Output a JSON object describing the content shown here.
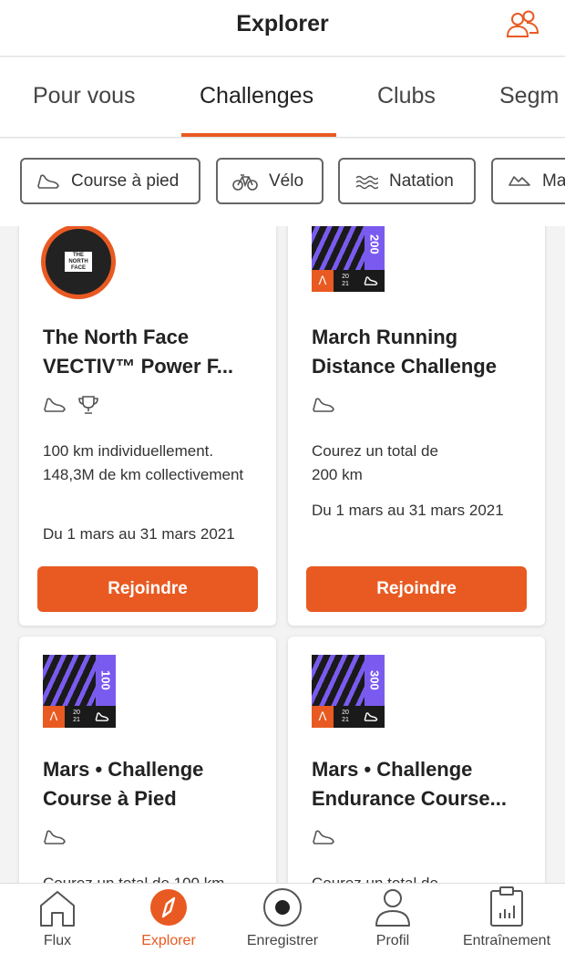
{
  "header": {
    "title": "Explorer",
    "people_icon": "people-icon"
  },
  "tabs": [
    {
      "label": "Pour vous"
    },
    {
      "label": "Challenges",
      "active": true
    },
    {
      "label": "Clubs"
    },
    {
      "label": "Segm"
    }
  ],
  "filters": [
    {
      "label": "Course à pied",
      "icon": "shoe-icon"
    },
    {
      "label": "Vélo",
      "icon": "bike-icon"
    },
    {
      "label": "Natation",
      "icon": "swim-icon"
    },
    {
      "label": "Ma",
      "icon": "hiking-icon"
    }
  ],
  "cards": [
    {
      "name": "The North Face VECTIV™ Power F...",
      "badge": {
        "type": "north-face",
        "text": [
          "THE",
          "NORTH",
          "FACE"
        ]
      },
      "icons": [
        "shoe-icon",
        "trophy-icon"
      ],
      "description": "100 km individuellement. 148,3M de km collectivement",
      "dates": "Du 1 mars au 31 mars 2021",
      "button": "Rejoindre"
    },
    {
      "name": "March Running Distance Challenge",
      "badge": {
        "type": "distance",
        "distance": "200",
        "year_top": "20",
        "year_bottom": "21"
      },
      "icons": [
        "shoe-icon"
      ],
      "description": "Courez un total de 200 km",
      "dates": "Du 1 mars au 31 mars 2021",
      "button": "Rejoindre"
    },
    {
      "name": "Mars • Challenge Course à Pied",
      "badge": {
        "type": "distance",
        "distance": "100",
        "year_top": "20",
        "year_bottom": "21"
      },
      "icons": [
        "shoe-icon"
      ],
      "description": "Courez un total de 100 km"
    },
    {
      "name": "Mars • Challenge Endurance Course...",
      "badge": {
        "type": "distance",
        "distance": "300",
        "year_top": "20",
        "year_bottom": "21"
      },
      "icons": [
        "shoe-icon"
      ],
      "description": "Courez un total de"
    }
  ],
  "bottom_nav": [
    {
      "label": "Flux",
      "icon": "home-icon"
    },
    {
      "label": "Explorer",
      "icon": "compass-icon",
      "active": true
    },
    {
      "label": "Enregistrer",
      "icon": "record-icon"
    },
    {
      "label": "Profil",
      "icon": "profile-icon"
    },
    {
      "label": "Entraînement",
      "icon": "training-icon"
    }
  ],
  "colors": {
    "accent": "#e85a22",
    "badge_purple": "#7a5bf0",
    "text": "#222222",
    "background": "#f3f3f3"
  }
}
